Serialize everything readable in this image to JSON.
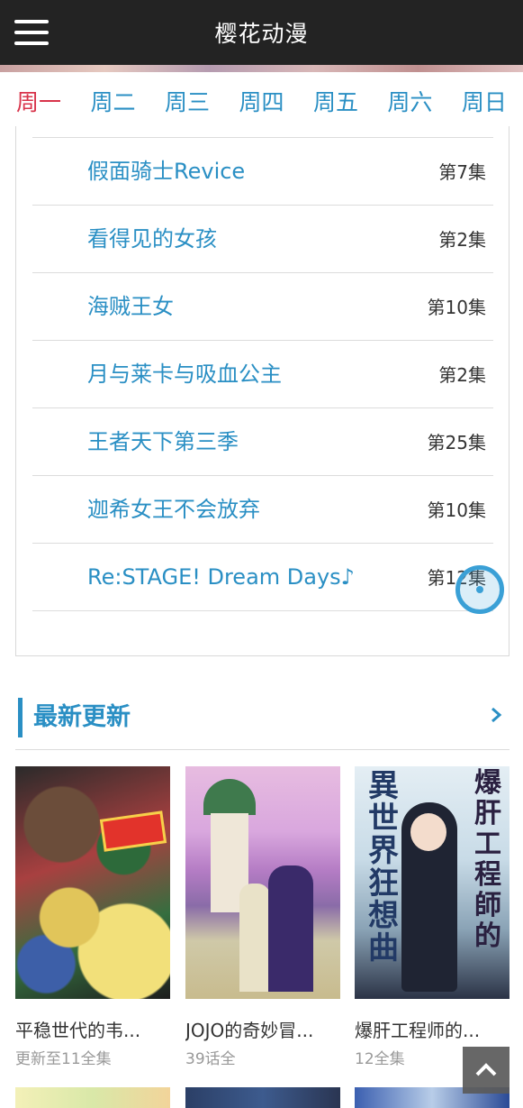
{
  "header": {
    "title": "樱花动漫",
    "menu_icon": "hamburger-menu-icon"
  },
  "weekdays": [
    "周一",
    "周二",
    "周三",
    "周四",
    "周五",
    "周六",
    "周日"
  ],
  "active_weekday": "周一",
  "schedule": [
    {
      "name": "假面骑士Revice",
      "episode": "第7集"
    },
    {
      "name": "看得见的女孩",
      "episode": "第2集"
    },
    {
      "name": "海贼王女",
      "episode": "第10集"
    },
    {
      "name": "月与莱卡与吸血公主",
      "episode": "第2集"
    },
    {
      "name": "王者天下第三季",
      "episode": "第25集"
    },
    {
      "name": "迦希女王不会放弃",
      "episode": "第10集"
    },
    {
      "name": "Re:STAGE! Dream Days♪",
      "episode": "第12集"
    }
  ],
  "latest": {
    "title": "最新更新",
    "more_icon": "chevron-right-icon",
    "items": [
      {
        "title": "平稳世代的韦...",
        "status": "更新至11全集"
      },
      {
        "title": "JOJO的奇妙冒...",
        "status": "39话全"
      },
      {
        "title": "爆肝工程师的...",
        "status": "12全集"
      }
    ],
    "cover3_text_left": "異世界狂想曲",
    "cover3_text_right": "爆肝工程師的"
  },
  "back_to_top_icon": "arrow-up-icon",
  "colors": {
    "header_bg": "#232323",
    "accent": "#2a8fc4",
    "active_tab": "#d8334a"
  }
}
